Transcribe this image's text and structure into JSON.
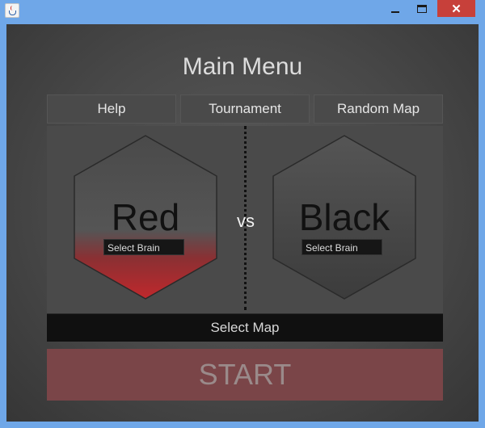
{
  "window": {
    "title": "",
    "icon": "java-cup-icon",
    "controls": {
      "minimize_icon": "minimize-icon",
      "maximize_icon": "maximize-icon",
      "close_symbol": "✕"
    }
  },
  "menu": {
    "title": "Main Menu",
    "buttons": {
      "help": "Help",
      "tournament": "Tournament",
      "random_map": "Random Map"
    }
  },
  "match": {
    "red": {
      "name": "Red",
      "brain_placeholder": "Select Brain",
      "accent": "#c0282c"
    },
    "black": {
      "name": "Black",
      "brain_placeholder": "Select Brain"
    },
    "vs": "vs"
  },
  "select_map": "Select Map",
  "start": "START",
  "colors": {
    "titlebar": "#6fa7e8",
    "close": "#c7403a",
    "start": "#7a4548"
  }
}
